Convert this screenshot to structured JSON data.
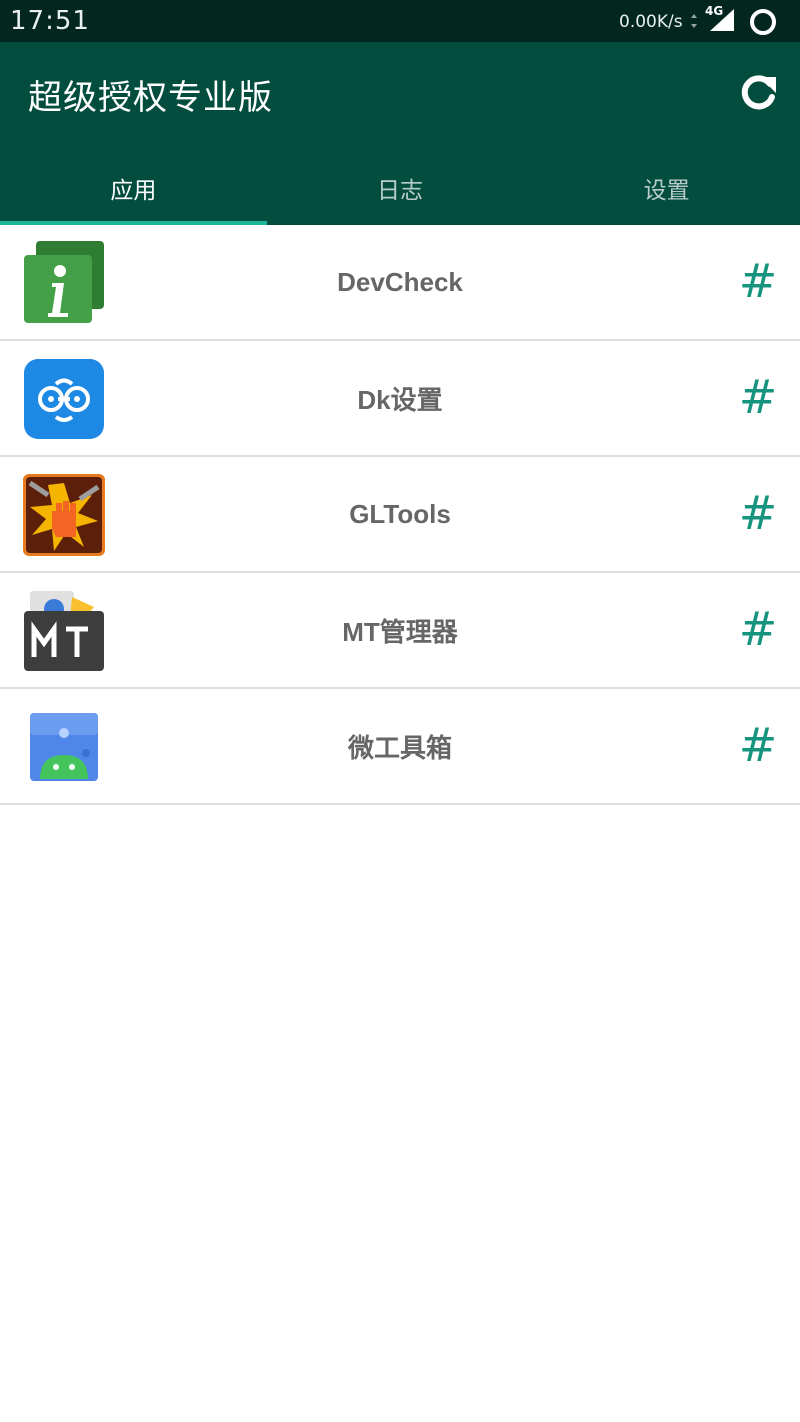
{
  "status_bar": {
    "time": "17:51",
    "net_speed": "0.00K/s",
    "network_type": "4G"
  },
  "app_bar": {
    "title": "超级授权专业版"
  },
  "tabs": [
    {
      "label": "应用",
      "active": true
    },
    {
      "label": "日志",
      "active": false
    },
    {
      "label": "设置",
      "active": false
    }
  ],
  "apps": [
    {
      "name": "DevCheck",
      "icon": "devcheck-icon",
      "action": "#"
    },
    {
      "name": "Dk设置",
      "icon": "dk-settings-icon",
      "action": "#"
    },
    {
      "name": "GLTools",
      "icon": "gltools-icon",
      "action": "#"
    },
    {
      "name": "MT管理器",
      "icon": "mt-manager-icon",
      "action": "#"
    },
    {
      "name": "微工具箱",
      "icon": "toolbox-icon",
      "action": "#"
    }
  ],
  "colors": {
    "status_bar": "#03261f",
    "app_bar": "#034d3f",
    "accent": "#16947e",
    "indicator": "#1fb59b"
  }
}
